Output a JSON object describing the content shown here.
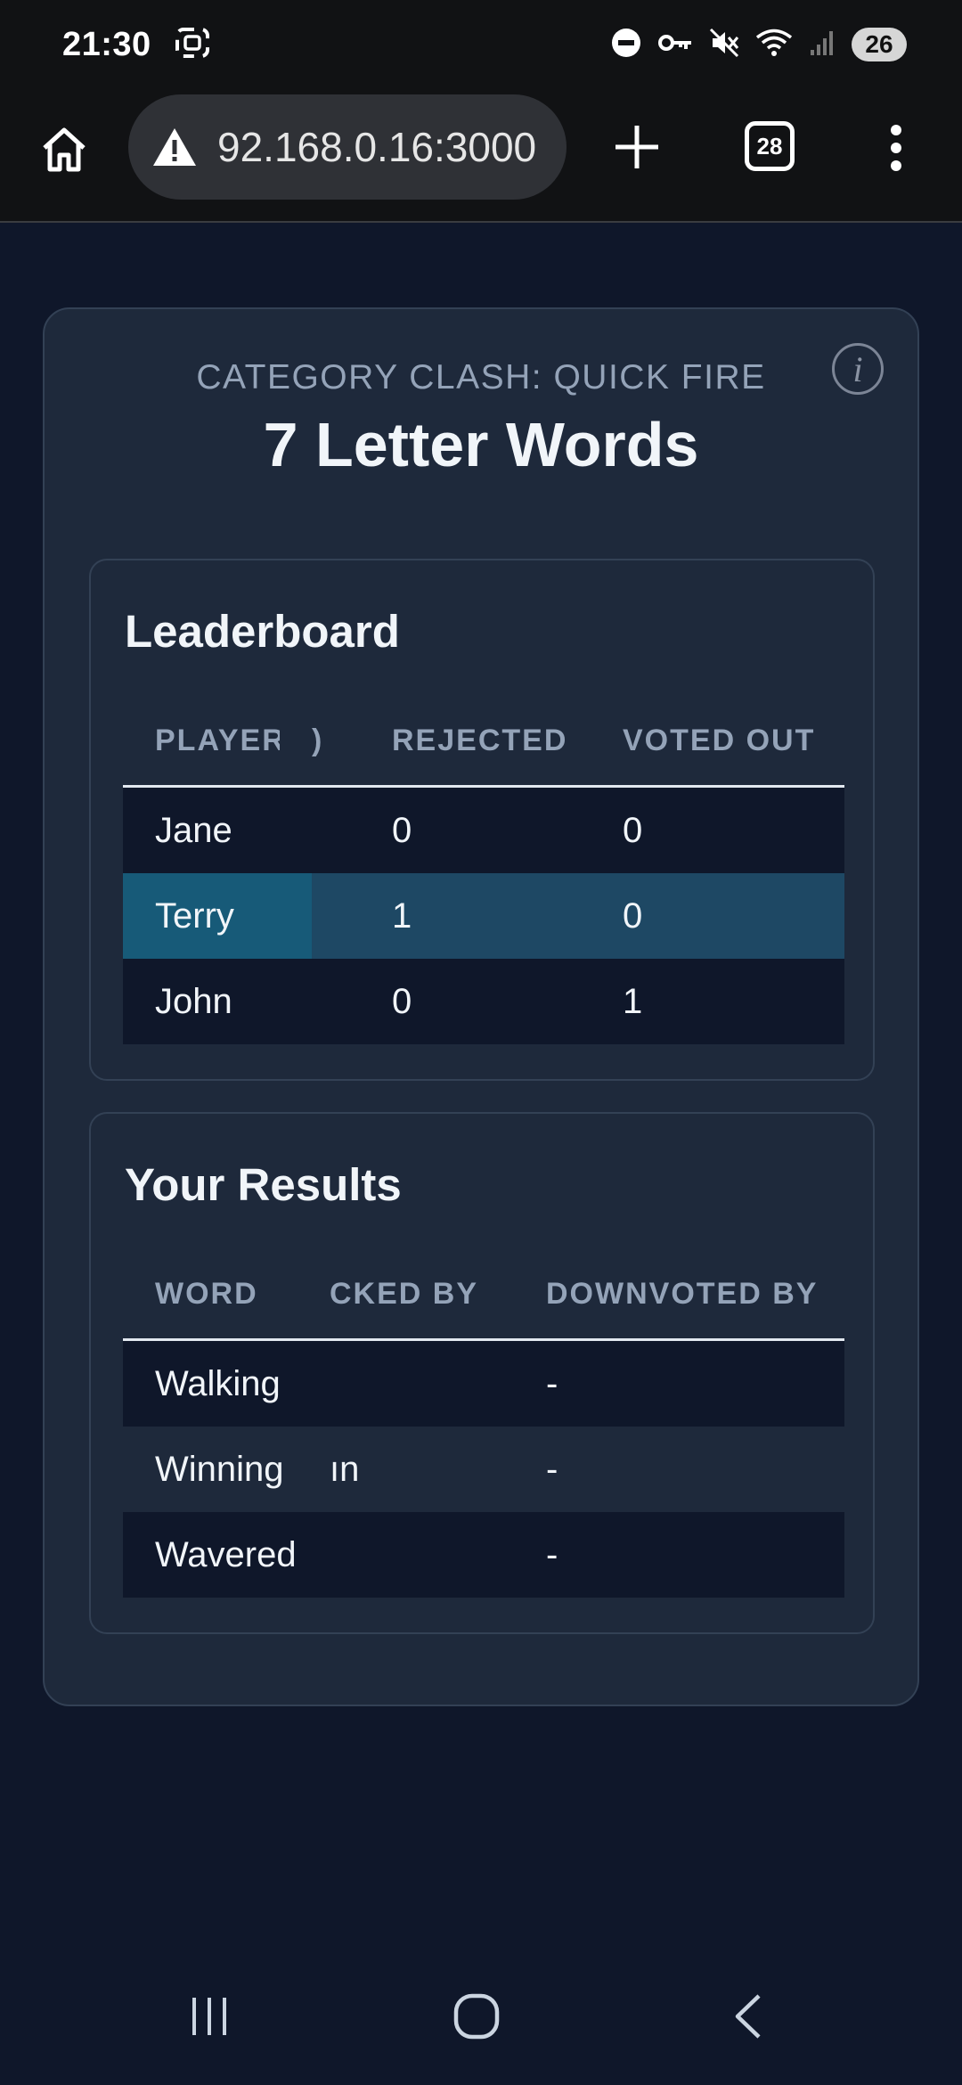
{
  "status_bar": {
    "time": "21:30",
    "battery": "26",
    "icons": [
      "screenshot-icon",
      "dnd-icon",
      "vpn-key-icon",
      "mute-icon",
      "wifi-icon",
      "signal-icon"
    ]
  },
  "browser": {
    "url": "92.168.0.16:3000",
    "tab_count": "28",
    "icons": [
      "home-icon",
      "warning-icon",
      "plus-icon",
      "more-vert-icon"
    ]
  },
  "header": {
    "subtitle": "CATEGORY CLASH: QUICK FIRE",
    "title": "7 Letter Words",
    "info_label": "i"
  },
  "leaderboard": {
    "title": "Leaderboard",
    "columns": [
      "PLAYER",
      ")",
      "REJECTED",
      "VOTED OUT"
    ],
    "rows": [
      {
        "player": "Jane",
        "rejected": "0",
        "voted_out": "0"
      },
      {
        "player": "Terry",
        "rejected": "1",
        "voted_out": "0"
      },
      {
        "player": "John",
        "rejected": "0",
        "voted_out": "1"
      }
    ]
  },
  "results": {
    "title": "Your Results",
    "columns": [
      "WORD",
      "CKED BY",
      "DOWNVOTED BY"
    ],
    "rows": [
      {
        "word": "Walking",
        "blocked_by": "",
        "downvoted_by": "-"
      },
      {
        "word": "Winning",
        "blocked_by": "ın",
        "downvoted_by": "-"
      },
      {
        "word": "Wavered",
        "blocked_by": "",
        "downvoted_by": "-"
      }
    ]
  },
  "nav": {
    "icons": [
      "recents-icon",
      "home-circle-icon",
      "back-icon"
    ]
  }
}
